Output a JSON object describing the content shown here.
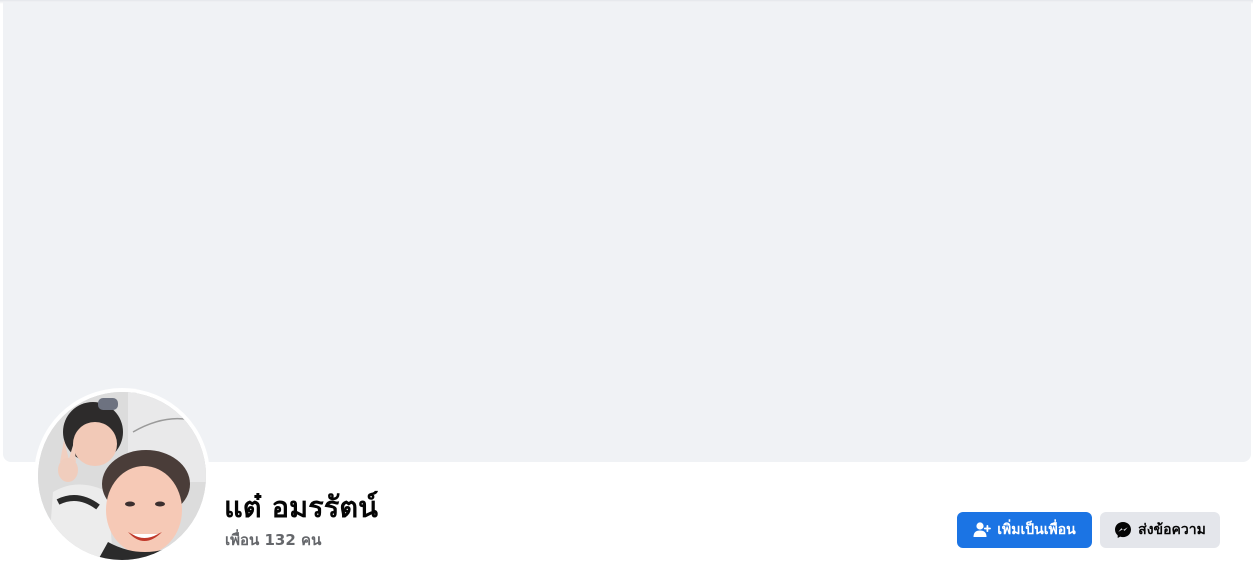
{
  "profile": {
    "name": "แต๋ อมรรัตน์",
    "friends_text": "เพื่อน 132 คน"
  },
  "actions": {
    "add_friend_label": "เพิ่มเป็นเพื่อน",
    "message_label": "ส่งข้อความ"
  },
  "icons": {
    "add_friend": "add-friend-icon",
    "message": "messenger-icon"
  },
  "colors": {
    "primary": "#1b74e4",
    "secondary_button": "#e4e6eb",
    "cover_bg": "#f0f2f5",
    "muted_text": "#65676b"
  }
}
